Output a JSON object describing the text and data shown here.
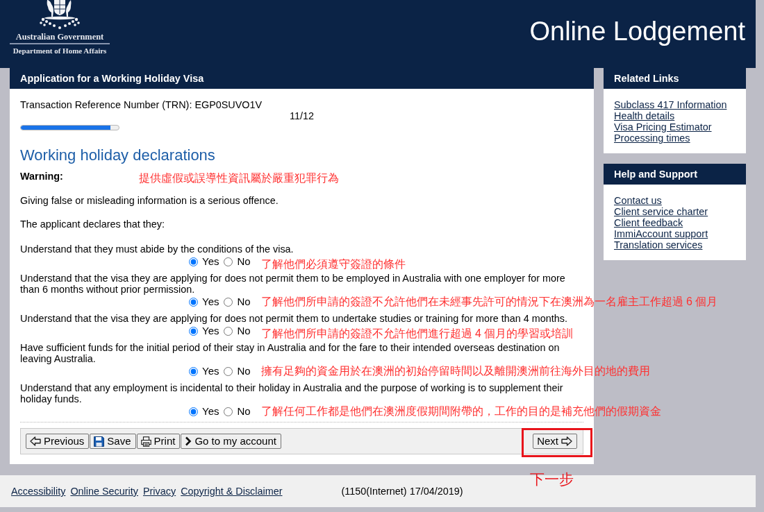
{
  "header": {
    "agency_lines": [
      "Australian Government",
      "Department of Home Affairs"
    ],
    "title": "Online Lodgement"
  },
  "application": {
    "title": "Application for a Working Holiday Visa",
    "reference": "Transaction Reference Number (TRN): EGP0SUVO1V",
    "progress": {
      "label": "11/12",
      "level": 0.917
    },
    "heading": "Working holiday declarations",
    "warning": {
      "label": "Warning:",
      "annotation": "提供虛假或誤導性資訊屬於嚴重犯罪行為"
    },
    "paragraphs": [
      "Giving false or misleading information is a serious offence.",
      "The applicant declares that they:"
    ],
    "declarations": [
      {
        "text": "Understand that they must abide by the conditions of the visa.",
        "options": [
          {
            "label": "Yes",
            "selected": true
          },
          {
            "label": "No",
            "selected": false
          }
        ],
        "annotation": "了解他們必須遵守簽證的條件"
      },
      {
        "text": "Understand that the visa they are applying for does not permit them to be employed in Australia with one employer for more than 6 months without prior permission.",
        "options": [
          {
            "label": "Yes",
            "selected": true
          },
          {
            "label": "No",
            "selected": false
          }
        ],
        "annotation": "了解他們所申請的簽證不允許他們在未經事先許可的情況下在澳洲為一名雇主工作超過 6 個月"
      },
      {
        "text": "Understand that the visa they are applying for does not permit them to undertake studies or training for more than 4 months.",
        "options": [
          {
            "label": "Yes",
            "selected": true
          },
          {
            "label": "No",
            "selected": false
          }
        ],
        "annotation": "了解他們所申請的簽證不允許他們進行超過 4 個月的學習或培訓"
      },
      {
        "text": "Have sufficient funds for the initial period of their stay in Australia and for the fare to their intended overseas destination on leaving Australia.",
        "options": [
          {
            "label": "Yes",
            "selected": true
          },
          {
            "label": "No",
            "selected": false
          }
        ],
        "annotation": "擁有足夠的資金用於在澳洲的初始停留時間以及離開澳洲前往海外目的地的費用"
      },
      {
        "text": "Understand that any employment is incidental to their holiday in Australia and the purpose of working is to supplement their holiday funds.",
        "options": [
          {
            "label": "Yes",
            "selected": true
          },
          {
            "label": "No",
            "selected": false
          }
        ],
        "annotation": "了解任何工作都是他們在澳洲度假期間附帶的，工作的目的是補充他們的假期資金"
      }
    ],
    "toolbar": {
      "buttons": [
        {
          "kind": "previous",
          "label": "Previous"
        },
        {
          "kind": "save",
          "label": "Save"
        },
        {
          "kind": "print",
          "label": "Print"
        },
        {
          "kind": "account",
          "label": "Go to my account"
        }
      ],
      "next": {
        "label": "Next",
        "highlighted": true,
        "annotation": "下一步"
      }
    }
  },
  "sidebar": [
    {
      "title": "Related Links",
      "links": [
        "Subclass 417 Information",
        "Health details",
        "Visa Pricing Estimator",
        "Processing times"
      ]
    },
    {
      "title": "Help and Support",
      "links": [
        "Contact us",
        "Client service charter",
        "Client feedback",
        "ImmiAccount support",
        "Translation services"
      ]
    }
  ],
  "footer": {
    "links": [
      "Accessibility",
      "Online Security",
      "Privacy",
      "Copyright & Disclaimer"
    ],
    "build": "(1150(Internet) 17/04/2019)"
  }
}
